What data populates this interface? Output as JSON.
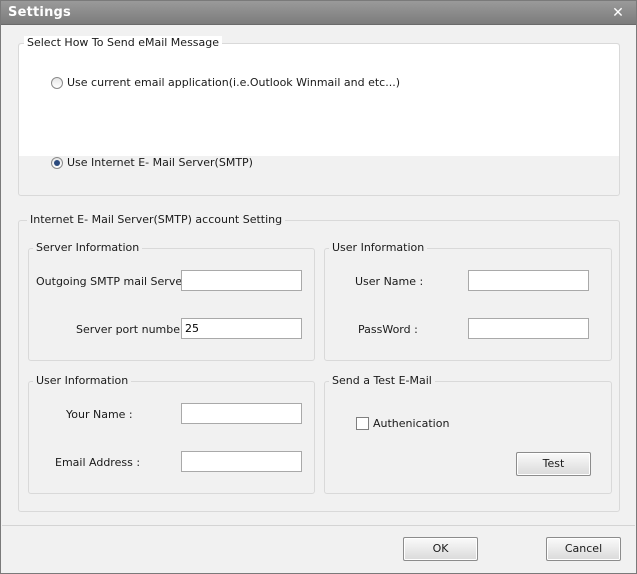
{
  "window": {
    "title": "Settings",
    "close_icon": "close-icon"
  },
  "send_method": {
    "legend": "Select How To Send eMail Message",
    "options": [
      {
        "label": "Use current email application(i.e.Outlook Winmail and etc...)",
        "selected": false
      },
      {
        "label": "Use Internet E- Mail Server(SMTP)",
        "selected": true
      }
    ]
  },
  "smtp": {
    "legend": "Internet E- Mail Server(SMTP) account Setting",
    "server_info": {
      "legend": "Server Information",
      "outgoing_label": "Outgoing SMTP mail Server:",
      "outgoing_value": "",
      "port_label": "Server port number :",
      "port_value": "25"
    },
    "user_info_auth": {
      "legend": "User Information",
      "username_label": "User Name :",
      "username_value": "",
      "password_label": "PassWord :",
      "password_value": ""
    },
    "user_info_sender": {
      "legend": "User Information",
      "yourname_label": "Your Name :",
      "yourname_value": "",
      "email_label": "Email Address :",
      "email_value": ""
    },
    "test": {
      "legend": "Send a Test E-Mail",
      "auth_label": "Authenication",
      "auth_checked": false,
      "test_button": "Test"
    }
  },
  "footer": {
    "ok": "OK",
    "cancel": "Cancel"
  }
}
